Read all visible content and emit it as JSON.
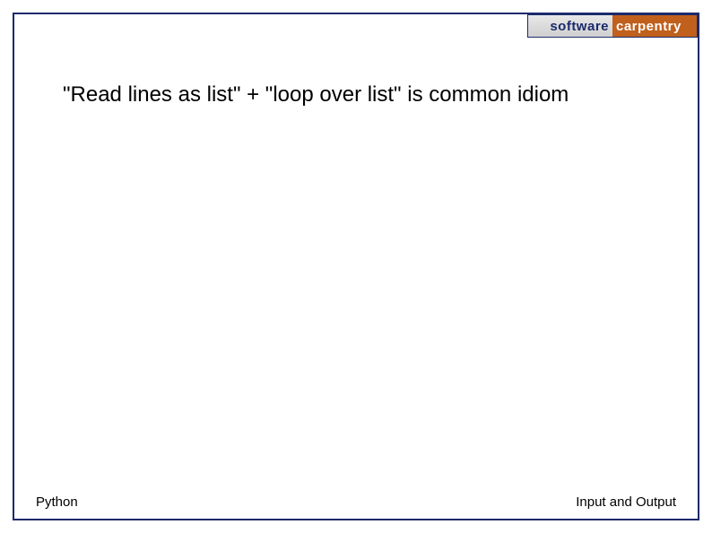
{
  "logo": {
    "left": "software",
    "right": "carpentry"
  },
  "main_text": "\"Read lines as list\" + \"loop over list\" is common idiom",
  "footer": {
    "left": "Python",
    "right": "Input and Output"
  }
}
